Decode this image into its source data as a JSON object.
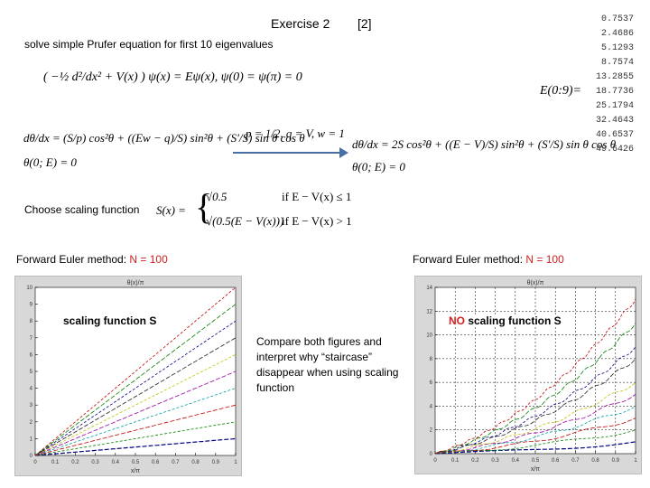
{
  "header": {
    "title": "Exercise 2",
    "ref": "[2]",
    "subtitle": "solve simple Prufer equation for first 10 eigenvalues"
  },
  "equations": {
    "schrodinger": "( −½ d²/dx² + V(x) ) ψ(x) = Eψ(x),  ψ(0) = ψ(π) = 0",
    "prufer_general": "dθ/dx = (S/p) cos²θ + ((Ew − q)/S) sin²θ + (S′/S) sin θ cos θ",
    "prufer_general_bc": "θ(0; E) = 0",
    "params": "p = 1/2, q = V, w = 1",
    "prufer_specific": "dθ/dx = 2S cos²θ + ((E − V)/S) sin²θ + (S′/S) sin θ cos θ",
    "prufer_specific_bc": "θ(0; E) = 0",
    "scaling_label": "Choose scaling function",
    "scaling_def": "S(x) =",
    "case1": "√0.5",
    "case1_cond": "if  E − V(x) ≤ 1",
    "case2": "√(0.5(E − V(x)))",
    "case2_cond": "if  E − V(x) > 1"
  },
  "eigenvalues": {
    "label": "E(0:9)=",
    "values": [
      "0.7537",
      "2.4686",
      "5.1293",
      "8.7574",
      "13.2855",
      "18.7736",
      "25.1794",
      "32.4643",
      "40.6537",
      "49.6426"
    ]
  },
  "left": {
    "heading_prefix": "Forward Euler method: ",
    "heading_n": "N = 100",
    "annotation": "scaling function S"
  },
  "right": {
    "heading_prefix": "Forward Euler method: ",
    "heading_n": "N = 100",
    "annotation_no": "NO",
    "annotation": " scaling function S"
  },
  "note": "Compare both figures and interpret why “staircase” disappear when using scaling function",
  "colors": {
    "accent": "#d02020",
    "series": [
      "#000080",
      "#008000",
      "#c00000",
      "#00a0a0",
      "#a000a0",
      "#c0c000",
      "#202020",
      "#000080",
      "#008000",
      "#c00000"
    ]
  },
  "chart_data": [
    {
      "type": "line",
      "title": "θ(x)/π",
      "xlabel": "x/π",
      "xlim": [
        0,
        1
      ],
      "ylim": [
        0,
        10
      ],
      "grid": false,
      "xticks": [
        "0",
        "0.1",
        "0.2",
        "0.3",
        "0.4",
        "0.5",
        "0.6",
        "0.7",
        "0.8",
        "0.9",
        "1"
      ],
      "yticks": [
        "0",
        "1",
        "2",
        "3",
        "4",
        "5",
        "6",
        "7",
        "8",
        "9",
        "10"
      ],
      "series_end_values": [
        1,
        2,
        3,
        4,
        5,
        6,
        7,
        8,
        9,
        10
      ]
    },
    {
      "type": "line",
      "title": "θ(x)/π",
      "xlabel": "x/π",
      "xlim": [
        0,
        1
      ],
      "ylim": [
        0,
        14
      ],
      "grid": true,
      "staircase": true,
      "xticks": [
        "0",
        "0.1",
        "0.2",
        "0.3",
        "0.4",
        "0.5",
        "0.6",
        "0.7",
        "0.8",
        "0.9",
        "1"
      ],
      "yticks": [
        "0",
        "2",
        "4",
        "6",
        "8",
        "10",
        "12",
        "14"
      ],
      "series_end_values": [
        1,
        2,
        3,
        4,
        5,
        6,
        8,
        9,
        11,
        13
      ]
    }
  ]
}
